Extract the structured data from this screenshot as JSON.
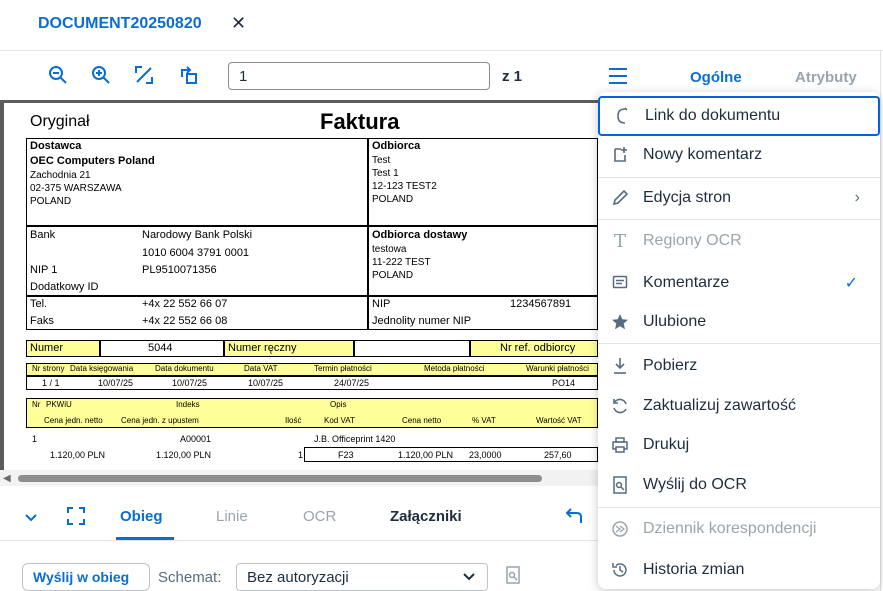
{
  "tab": {
    "title": "DOCUMENT20250820",
    "close_glyph": "✕"
  },
  "toolbar": {
    "page_value": "1",
    "page_of": "z 1",
    "icons": [
      "zoom-out-icon",
      "zoom-in-icon",
      "fit-page-icon",
      "rotate-icon",
      "menu-icon"
    ]
  },
  "side_tabs": {
    "general": "Ogólne",
    "attributes": "Atrybuty"
  },
  "invoice": {
    "original": "Oryginał",
    "title": "Faktura",
    "supplier_h": "Dostawca",
    "supplier_name": "OEC Computers Poland",
    "supplier_addr1": "Zachodnia 21",
    "supplier_addr2": "02-375 WARSZAWA",
    "supplier_addr3": "POLAND",
    "recipient_h": "Odbiorca",
    "recipient_1": "Test",
    "recipient_2": "Test 1",
    "recipient_3": "12-123 TEST2",
    "recipient_4": "POLAND",
    "bank_l": "Bank",
    "bank_v": "Narodowy Bank Polski",
    "bank_acc": "1010 6004 3791 0001",
    "nip_l": "NIP 1",
    "nip_v": "PL9510071356",
    "extra_id": "Dodatkowy ID",
    "delivery_h": "Odbiorca dostawy",
    "delivery_1": "testowa",
    "delivery_2": "11-222 TEST",
    "delivery_3": "POLAND",
    "tel_l": "Tel.",
    "tel_v": "+4x 22 552 66 07",
    "fax_l": "Faks",
    "fax_v": "+4x 22 552 66 08",
    "nip2_l": "NIP",
    "nip2_v": "1234567891",
    "unified_nip": "Jednolity numer NIP",
    "number_l": "Numer",
    "number_v": "5044",
    "manual_no": "Numer ręczny",
    "recipient_ref": "Nr ref. odbiorcy",
    "h_page": "Nr strony",
    "h_booking": "Data księgowania",
    "h_docdate": "Data dokumentu",
    "h_vatdate": "Data VAT",
    "h_due": "Termin płatności",
    "h_method": "Metoda płatności",
    "h_terms": "Warunki płatności",
    "v_page": "1 / 1",
    "v_booking": "10/07/25",
    "v_docdate": "10/07/25",
    "v_vatdate": "10/07/25",
    "v_due": "24/07/25",
    "v_terms": "PO14",
    "h_nr": "Nr",
    "h_pkwiu": "PKWiU",
    "h_index": "Indeks",
    "h_desc": "Opis",
    "h_netunit": "Cena jedn. netto",
    "h_discunit": "Cena jedn. z upustem",
    "h_qty": "Ilość",
    "h_vatcode": "Kod VAT",
    "h_net": "Cena netto",
    "h_vatpct": "% VAT",
    "h_vatval": "Wartość VAT",
    "r_nr": "1",
    "r_index": "A00001",
    "r_desc": "J.B. Officeprint 1420",
    "r_netunit": "1.120,00 PLN",
    "r_discunit": "1.120,00 PLN",
    "r_qty": "1",
    "r_vatcode": "F23",
    "r_net": "1.120,00 PLN",
    "r_vatpct": "23,0000",
    "r_vatval": "257,60"
  },
  "bottom": {
    "tabs": {
      "flow": "Obieg",
      "lines": "Linie",
      "ocr": "OCR",
      "attachments": "Załączniki"
    },
    "send_button": "Wyślij w obieg",
    "schema_label": "Schemat:",
    "schema_value": "Bez autoryzacji"
  },
  "menu": {
    "items": [
      {
        "label": "Link do dokumentu",
        "icon": "link-icon"
      },
      {
        "label": "Nowy komentarz",
        "icon": "add-comment-icon"
      },
      {
        "label": "Edycja stron",
        "icon": "edit-pages-icon",
        "submenu": "›"
      },
      {
        "label": "Regiony OCR",
        "icon": "text-icon",
        "disabled": true
      },
      {
        "label": "Komentarze",
        "icon": "comments-icon",
        "checked": "✓"
      },
      {
        "label": "Ulubione",
        "icon": "star-icon"
      },
      {
        "label": "Pobierz",
        "icon": "download-icon"
      },
      {
        "label": "Zaktualizuj zawartość",
        "icon": "refresh-icon"
      },
      {
        "label": "Drukuj",
        "icon": "print-icon"
      },
      {
        "label": "Wyślij do OCR",
        "icon": "ocr-document-icon"
      },
      {
        "label": "Dziennik korespondencji",
        "icon": "journal-icon",
        "disabled": true
      },
      {
        "label": "Historia zmian",
        "icon": "history-icon"
      }
    ]
  },
  "colors": {
    "accent": "#0a6ed1",
    "text": "#1d2d3e",
    "muted": "#9aa4ae",
    "highlight": "#ffff99"
  }
}
